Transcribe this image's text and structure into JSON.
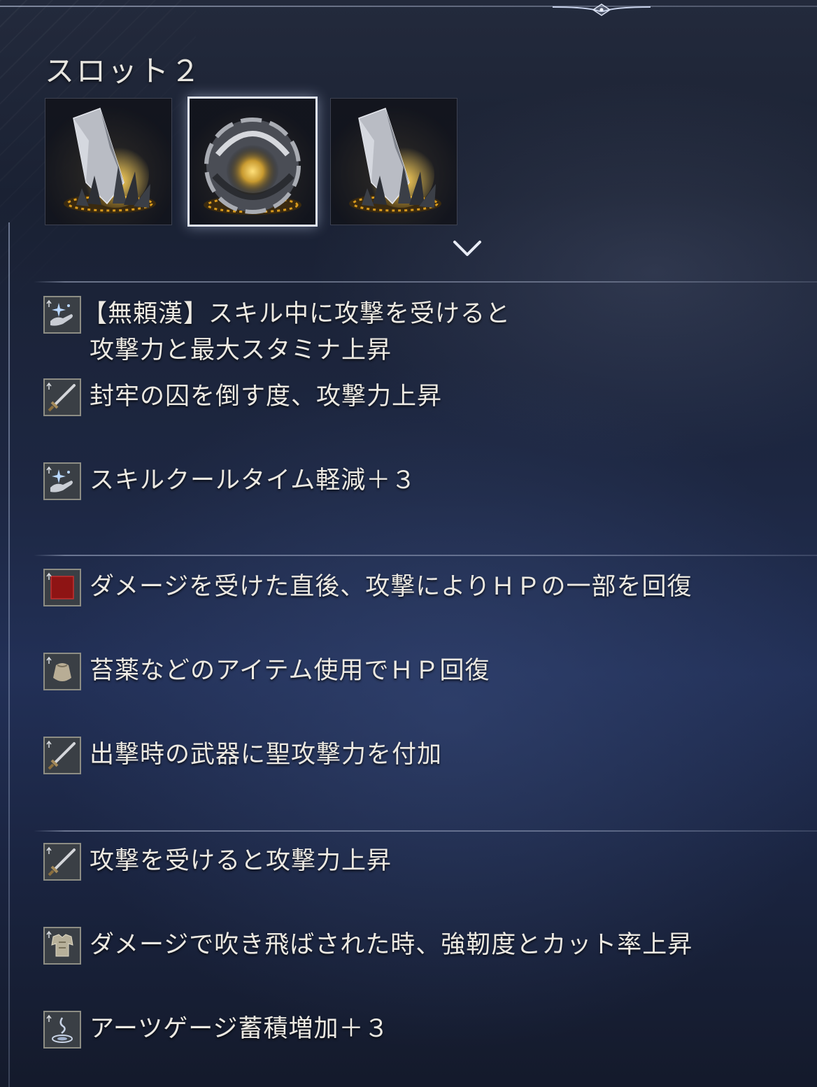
{
  "slot": {
    "title": "スロット２"
  },
  "relics": [
    {
      "icon": "crystal-relic-icon"
    },
    {
      "icon": "orb-relic-icon",
      "selected": true
    },
    {
      "icon": "crystal-relic-icon"
    }
  ],
  "effect_groups": [
    {
      "effects": [
        {
          "icon": "skill-hand-icon",
          "line1": "【無頼漢】スキル中に攻撃を受けると",
          "line2": "攻撃力と最大スタミナ上昇"
        },
        {
          "icon": "sword-icon",
          "line1": "封牢の囚を倒す度、攻撃力上昇"
        },
        {
          "icon": "skill-hand-icon",
          "line1": "スキルクールタイム軽減＋３"
        }
      ]
    },
    {
      "effects": [
        {
          "icon": "red-square-icon",
          "line1": "ダメージを受けた直後、攻撃によりＨＰの一部を回復"
        },
        {
          "icon": "pouch-icon",
          "line1": "苔薬などのアイテム使用でＨＰ回復"
        },
        {
          "icon": "sword-icon",
          "line1": "出撃時の武器に聖攻撃力を付加"
        }
      ]
    },
    {
      "effects": [
        {
          "icon": "sword-icon",
          "line1": "攻撃を受けると攻撃力上昇"
        },
        {
          "icon": "armor-icon",
          "line1": "ダメージで吹き飛ばされた時、強靭度とカット率上昇"
        },
        {
          "icon": "arts-swirl-icon",
          "line1": "アーツゲージ蓄積増加＋３"
        }
      ]
    }
  ]
}
